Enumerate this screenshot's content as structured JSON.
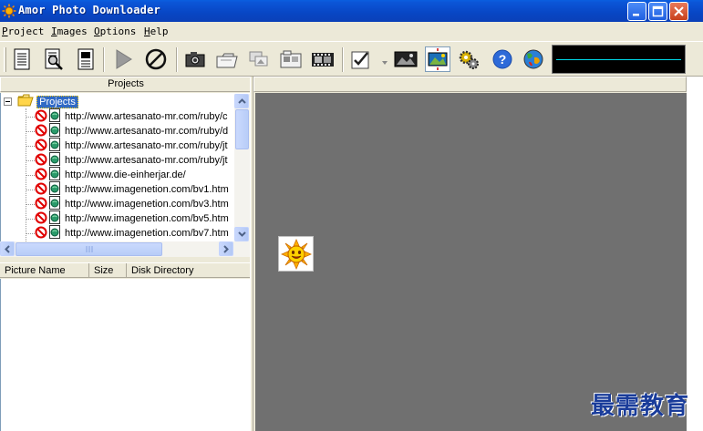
{
  "window": {
    "title": "Amor Photo Downloader"
  },
  "menu": [
    "Project",
    "Images",
    "Options",
    "Help"
  ],
  "toolbar": {
    "buttons": [
      "new-project-icon",
      "search-page-icon",
      "document-list-icon",
      "play-icon",
      "stop-icon",
      "camera-icon",
      "open-folder-icon",
      "photos-icon",
      "folder-images-icon",
      "film-icon",
      "checklist-icon",
      "image-dark-icon",
      "image-viewer-icon",
      "settings-gears-icon",
      "help-icon",
      "globe-icon"
    ]
  },
  "projects_panel": {
    "header": "Projects",
    "root_label": "Projects",
    "items": [
      "http://www.artesanato-mr.com/ruby/c",
      "http://www.artesanato-mr.com/ruby/d",
      "http://www.artesanato-mr.com/ruby/jt",
      "http://www.artesanato-mr.com/ruby/jt",
      "http://www.die-einherjar.de/",
      "http://www.imagenetion.com/bv1.htm",
      "http://www.imagenetion.com/bv3.htm",
      "http://www.imagenetion.com/bv5.htm",
      "http://www.imagenetion.com/bv7.htm"
    ]
  },
  "file_list": {
    "columns": [
      "Picture Name",
      "Size",
      "Disk Directory"
    ]
  },
  "watermark": "最需教育",
  "colors": {
    "title_bar": "#0a4fd0",
    "canvas": "#707070",
    "selection": "#316ac5",
    "monitor_line": "#00d8e8"
  }
}
